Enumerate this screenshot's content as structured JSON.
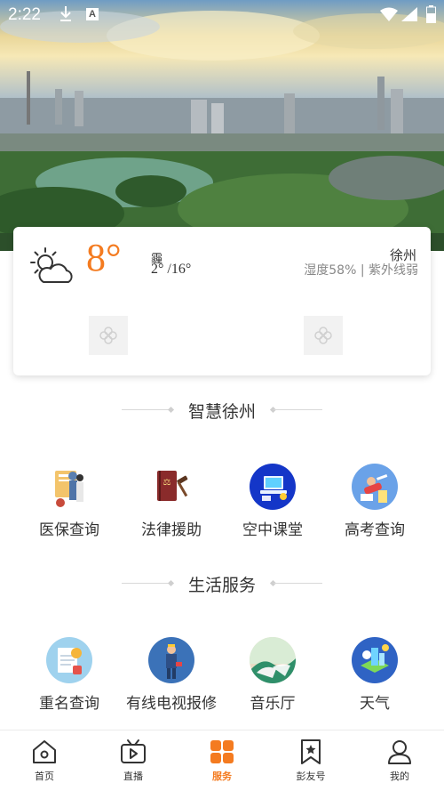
{
  "status": {
    "time": "2:22"
  },
  "weather": {
    "temperature": "8°",
    "condition": "霾",
    "range": "2° /16°",
    "city": "徐州",
    "humidity_uv": "湿度58%  |  紫外线弱"
  },
  "sections": [
    {
      "title": "智慧徐州",
      "items": [
        {
          "label": "医保查询",
          "icon": "medical-insurance-icon"
        },
        {
          "label": "法律援助",
          "icon": "legal-aid-icon"
        },
        {
          "label": "空中课堂",
          "icon": "online-class-icon"
        },
        {
          "label": "高考查询",
          "icon": "exam-query-icon"
        }
      ]
    },
    {
      "title": "生活服务",
      "items": [
        {
          "label": "重名查询",
          "icon": "name-query-icon"
        },
        {
          "label": "有线电视报修",
          "icon": "cable-tv-repair-icon"
        },
        {
          "label": "音乐厅",
          "icon": "concert-hall-icon"
        },
        {
          "label": "天气",
          "icon": "weather-icon"
        }
      ]
    }
  ],
  "tabs": [
    {
      "label": "首页",
      "icon": "home-icon"
    },
    {
      "label": "直播",
      "icon": "live-tv-icon"
    },
    {
      "label": "服务",
      "icon": "service-grid-icon",
      "active": true
    },
    {
      "label": "彭友号",
      "icon": "bookmark-star-icon"
    },
    {
      "label": "我的",
      "icon": "profile-icon"
    }
  ],
  "colors": {
    "accent": "#f47b20",
    "text": "#333333",
    "muted": "#888888"
  }
}
